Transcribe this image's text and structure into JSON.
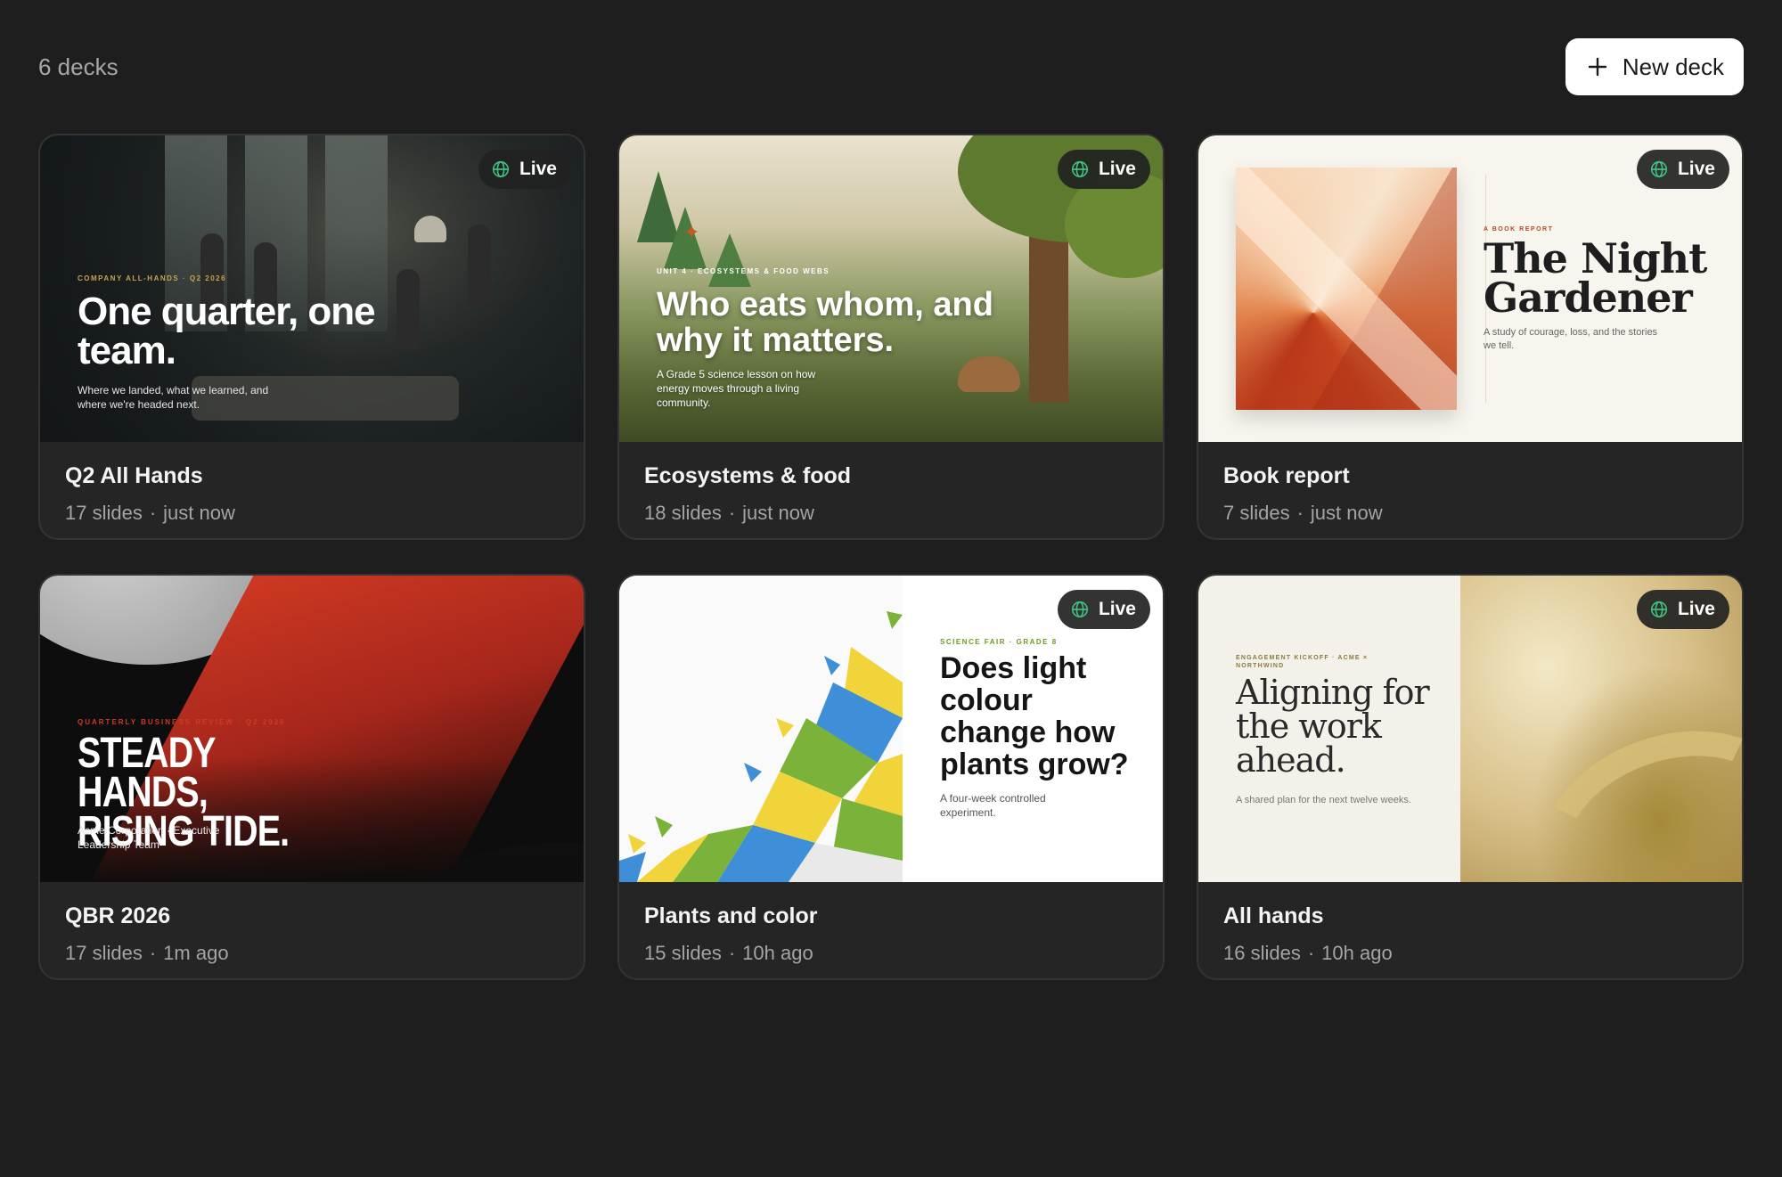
{
  "header": {
    "deck_count": "6 decks",
    "new_deck_label": "New deck"
  },
  "live_label": "Live",
  "decks": [
    {
      "title": "Q2 All Hands",
      "slides": "17 slides",
      "updated": "just now",
      "thumbnail": {
        "overline": "COMPANY ALL-HANDS · Q2 2026",
        "heading": "One quarter, one team.",
        "sub": "Where we landed, what we learned, and where we're headed next."
      }
    },
    {
      "title": "Ecosystems & food",
      "slides": "18 slides",
      "updated": "just now",
      "thumbnail": {
        "overline": "UNIT 4 · ECOSYSTEMS & FOOD WEBS",
        "heading": "Who eats whom, and why it matters.",
        "sub": "A Grade 5 science lesson on how energy moves through a living community."
      }
    },
    {
      "title": "Book report",
      "slides": "7 slides",
      "updated": "just now",
      "thumbnail": {
        "overline": "A BOOK REPORT",
        "heading": "The Night Gardener",
        "sub": "A study of courage, loss, and the stories we tell."
      }
    },
    {
      "title": "QBR 2026",
      "slides": "17 slides",
      "updated": "1m ago",
      "thumbnail": {
        "overline": "QUARTERLY BUSINESS REVIEW · Q2 2026",
        "heading": "STEADY HANDS, RISING TIDE.",
        "sub": "Acme Corporation · Executive Leadership Team"
      }
    },
    {
      "title": "Plants and color",
      "slides": "15 slides",
      "updated": "10h ago",
      "thumbnail": {
        "overline": "SCIENCE FAIR · GRADE 8",
        "heading": "Does light colour change how plants grow?",
        "sub": "A four-week controlled experiment."
      }
    },
    {
      "title": "All hands",
      "slides": "16 slides",
      "updated": "10h ago",
      "thumbnail": {
        "overline": "ENGAGEMENT KICKOFF · ACME × NORTHWIND",
        "heading": "Aligning for the work ahead.",
        "sub": "A shared plan for the next twelve weeks."
      }
    }
  ],
  "meta_separator": "·",
  "colors": {
    "background": "#1e1e1e",
    "card": "#252525",
    "live_globe": "#3fbf7f"
  },
  "icons": {
    "new_deck": "plus-icon",
    "live": "globe-icon"
  }
}
